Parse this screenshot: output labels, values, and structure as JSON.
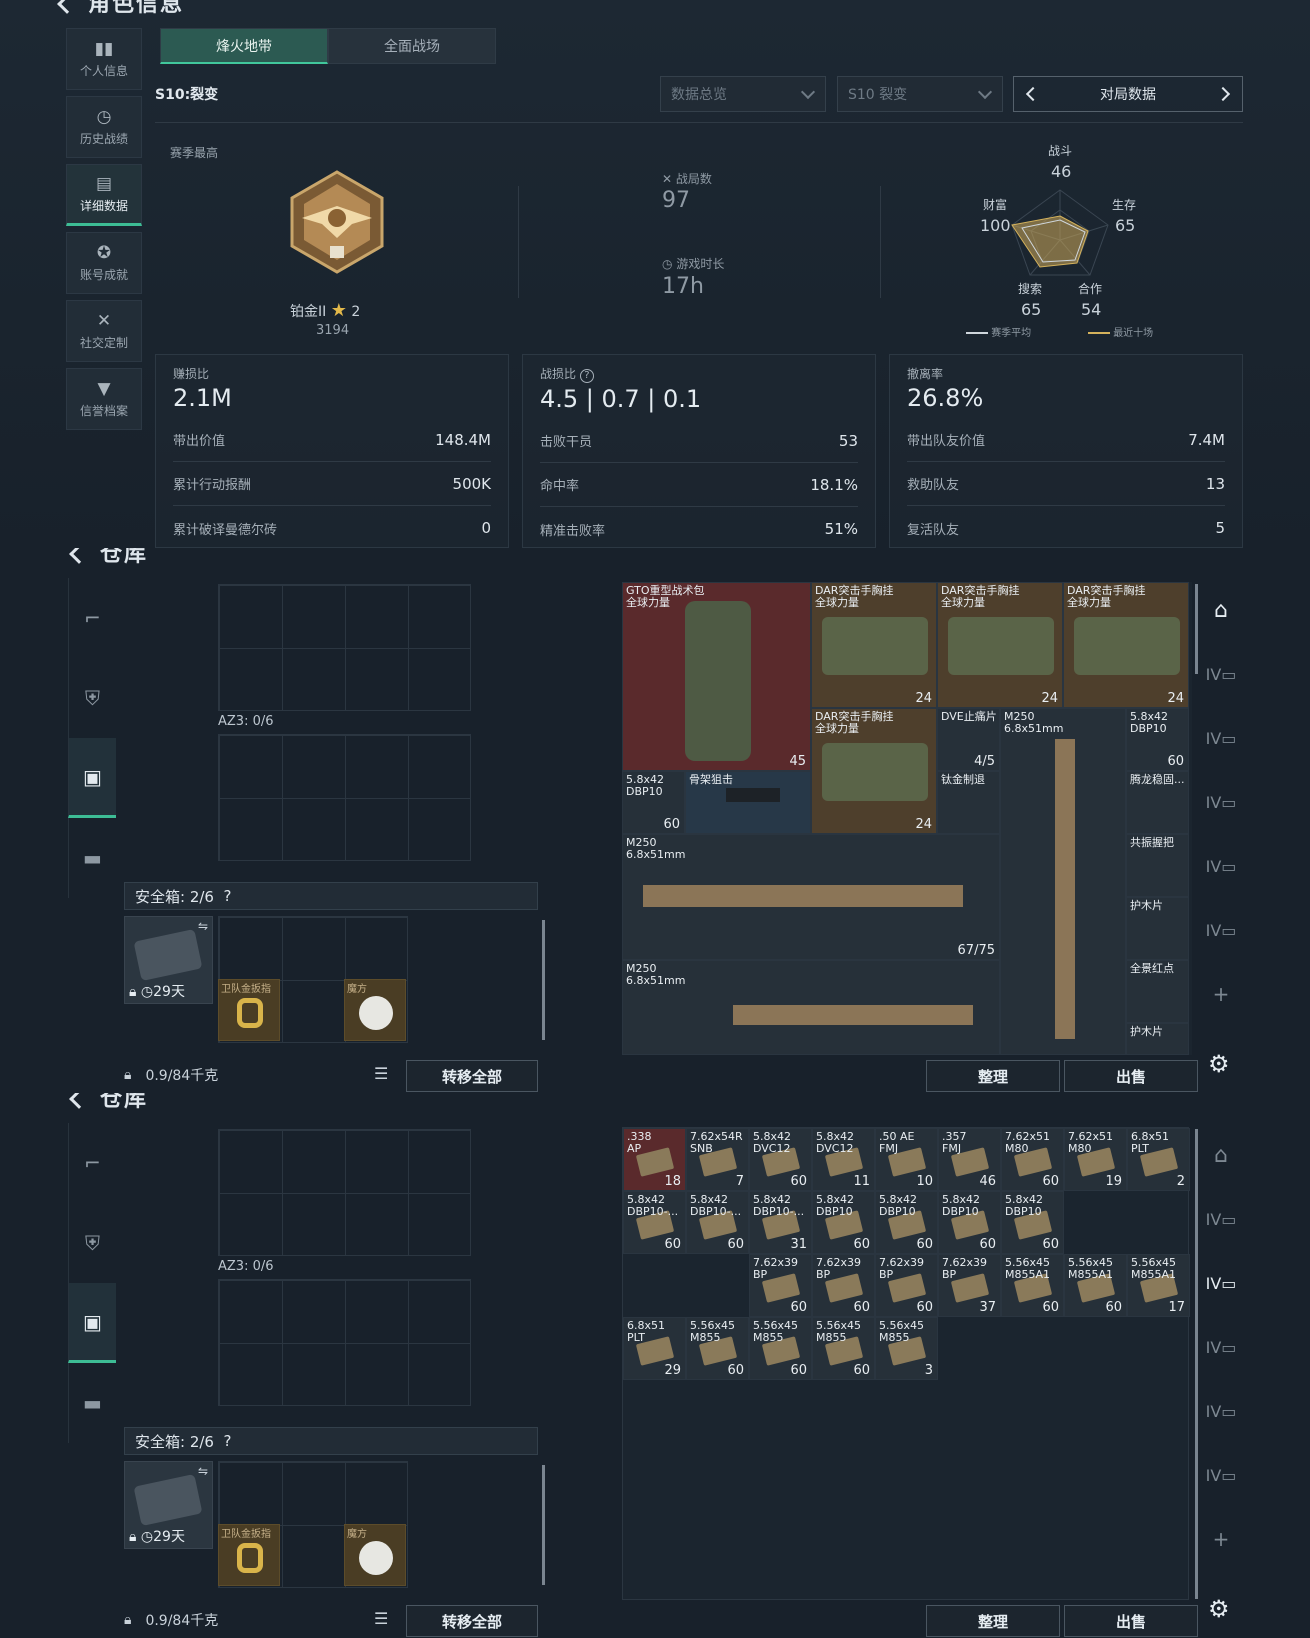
{
  "p1": {
    "title": "角色信息",
    "nav": [
      {
        "icon": "bar-chart-icon",
        "label": "个人信息"
      },
      {
        "icon": "history-icon",
        "label": "历史战绩"
      },
      {
        "icon": "folder-icon",
        "label": "详细数据"
      },
      {
        "icon": "medal-icon",
        "label": "账号成就"
      },
      {
        "icon": "social-icon",
        "label": "社交定制"
      },
      {
        "icon": "shield-icon",
        "label": "信誉档案"
      }
    ],
    "tabs": [
      "烽火地带",
      "全面战场"
    ],
    "season": "S10:裂变",
    "dropdown1": "数据总览",
    "dropdown2": "S10 裂变",
    "match_btn": "对局数据",
    "season_high": "赛季最高",
    "rank": "铂金II",
    "stars": "2",
    "rank_points": "3194",
    "games_label": "战局数",
    "games": "97",
    "time_label": "游戏时长",
    "time": "17h",
    "radar": {
      "labels": {
        "combat": "战斗",
        "survival": "生存",
        "cooperation": "合作",
        "search": "搜索",
        "wealth": "财富"
      },
      "values": {
        "combat": "46",
        "survival": "65",
        "cooperation": "54",
        "search": "65",
        "wealth": "100"
      },
      "legend_avg": "赛季平均",
      "legend_recent": "最近十场"
    },
    "cards": [
      {
        "title": "赚损比",
        "big": "2.1M",
        "rows": [
          [
            "带出价值",
            "148.4M"
          ],
          [
            "累计行动报酬",
            "500K"
          ],
          [
            "累计破译曼德尔砖",
            "0"
          ]
        ]
      },
      {
        "title": "战损比",
        "big": "4.5 | 0.7 | 0.1",
        "rows": [
          [
            "击败干员",
            "53"
          ],
          [
            "命中率",
            "18.1%"
          ],
          [
            "精准击败率",
            "51%"
          ]
        ]
      },
      {
        "title": "撤离率",
        "big": "26.8%",
        "rows": [
          [
            "带出队友价值",
            "7.4M"
          ],
          [
            "救助队友",
            "13"
          ],
          [
            "复活队友",
            "5"
          ]
        ]
      }
    ]
  },
  "wh": {
    "title": "仓库",
    "az": "AZ3: 0/6",
    "safebox": "安全箱:  2/6",
    "days": "29天",
    "ring": "卫队金扳指",
    "cube": "魔方",
    "weight": "0.9/84千克",
    "transfer": "转移全部",
    "sort": "整理",
    "sell": "出售"
  },
  "stash1": [
    {
      "n": "GTO重型战术包\n全球力量",
      "c": "45",
      "cls": "red"
    },
    {
      "n": "DAR突击手胸挂\n全球力量",
      "c": "24",
      "cls": "brn"
    },
    {
      "n": "DAR突击手胸挂\n全球力量",
      "c": "24",
      "cls": "brn"
    },
    {
      "n": "DAR突击手胸挂\n全球力量",
      "c": "24",
      "cls": "brn"
    },
    {
      "n": "DAR突击手胸挂\n全球力量",
      "c": "24",
      "cls": "brn"
    },
    {
      "n": "DVE止痛片",
      "c": "4/5",
      "cls": "gry"
    },
    {
      "n": "M250\n6.8x51mm",
      "c": "",
      "cls": "gry"
    },
    {
      "n": "5.8x42\nDBP10",
      "c": "60",
      "cls": "gry"
    },
    {
      "n": "5.8x42\nDBP10",
      "c": "60",
      "cls": "gry"
    },
    {
      "n": "骨架狙击",
      "c": "",
      "cls": "blu"
    },
    {
      "n": "钛金制退",
      "c": "",
      "cls": "gry"
    },
    {
      "n": "腾龙稳固...",
      "c": "",
      "cls": "gry"
    },
    {
      "n": "共振握把",
      "c": "",
      "cls": "gry"
    },
    {
      "n": "M250\n6.8x51mm",
      "c": "67/75",
      "cls": "gry"
    },
    {
      "n": "护木片",
      "c": "",
      "cls": "gry"
    },
    {
      "n": "全景红点",
      "c": "",
      "cls": "gry"
    },
    {
      "n": "M250\n6.8x51mm",
      "c": "",
      "cls": "gry"
    },
    {
      "n": "护木片",
      "c": "",
      "cls": "gry"
    }
  ],
  "stash2": [
    {
      "n": ".338\nAP",
      "c": "18",
      "cls": "red"
    },
    {
      "n": "7.62x54R\nSNB",
      "c": "7",
      "cls": "gry"
    },
    {
      "n": "5.8x42\nDVC12",
      "c": "60",
      "cls": "gry"
    },
    {
      "n": "5.8x42\nDVC12",
      "c": "11",
      "cls": "gry"
    },
    {
      "n": ".50 AE\nFMJ",
      "c": "10",
      "cls": "gry"
    },
    {
      "n": ".357\nFMJ",
      "c": "46",
      "cls": "gry"
    },
    {
      "n": "7.62x51\nM80",
      "c": "60",
      "cls": "gry"
    },
    {
      "n": "7.62x51\nM80",
      "c": "19",
      "cls": "gry"
    },
    {
      "n": "6.8x51\nPLT",
      "c": "2",
      "cls": "gry"
    },
    {
      "n": "5.8x42\nDBP10-...",
      "c": "60",
      "cls": "gry"
    },
    {
      "n": "5.8x42\nDBP10-...",
      "c": "60",
      "cls": "gry"
    },
    {
      "n": "5.8x42\nDBP10-...",
      "c": "31",
      "cls": "gry"
    },
    {
      "n": "5.8x42\nDBP10",
      "c": "60",
      "cls": "gry"
    },
    {
      "n": "5.8x42\nDBP10",
      "c": "60",
      "cls": "gry"
    },
    {
      "n": "5.8x42\nDBP10",
      "c": "60",
      "cls": "gry"
    },
    {
      "n": "5.8x42\nDBP10",
      "c": "60",
      "cls": "gry"
    },
    {
      "n": "7.62x39\nBP",
      "c": "60",
      "cls": "gry"
    },
    {
      "n": "7.62x39\nBP",
      "c": "60",
      "cls": "gry"
    },
    {
      "n": "7.62x39\nBP",
      "c": "60",
      "cls": "gry"
    },
    {
      "n": "7.62x39\nBP",
      "c": "37",
      "cls": "gry"
    },
    {
      "n": "5.56x45\nM855A1",
      "c": "60",
      "cls": "gry"
    },
    {
      "n": "5.56x45\nM855A1",
      "c": "60",
      "cls": "gry"
    },
    {
      "n": "5.56x45\nM855A1",
      "c": "17",
      "cls": "gry"
    },
    {
      "n": "6.8x51\nPLT",
      "c": "29",
      "cls": "gry"
    },
    {
      "n": "5.56x45\nM855",
      "c": "60",
      "cls": "gry"
    },
    {
      "n": "5.56x45\nM855",
      "c": "60",
      "cls": "gry"
    },
    {
      "n": "5.56x45\nM855",
      "c": "60",
      "cls": "gry"
    },
    {
      "n": "5.56x45\nM855",
      "c": "3",
      "cls": "gry"
    }
  ]
}
